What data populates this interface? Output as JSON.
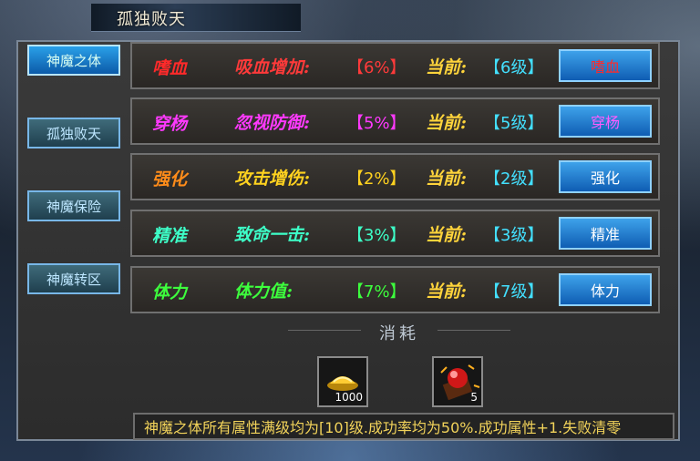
{
  "window": {
    "title": "孤独败天"
  },
  "sidebar": {
    "items": [
      {
        "label": "神魔之体",
        "active": true
      },
      {
        "label": "孤独败天",
        "active": false
      },
      {
        "label": "神魔保险",
        "active": false
      },
      {
        "label": "神魔转区",
        "active": false
      }
    ]
  },
  "rows": [
    {
      "name": "嗜血",
      "desc": "吸血增加:",
      "pct": "【6%】",
      "cur_label": "当前:",
      "level": "【6级】",
      "button": "嗜血",
      "name_color": "#ff2a2a",
      "desc_color": "#ff3a3a",
      "pct_color": "#ff3a3a",
      "btn_color": "#ff2a2a"
    },
    {
      "name": "穿杨",
      "desc": "忽视防御:",
      "pct": "【5%】",
      "cur_label": "当前:",
      "level": "【5级】",
      "button": "穿杨",
      "name_color": "#ff39ff",
      "desc_color": "#ff39ff",
      "pct_color": "#ff39ff",
      "btn_color": "#ff5cff"
    },
    {
      "name": "强化",
      "desc": "攻击增伤:",
      "pct": "【2%】",
      "cur_label": "当前:",
      "level": "【2级】",
      "button": "强化",
      "name_color": "#ff8c1a",
      "desc_color": "#ffd21f",
      "pct_color": "#ffd21f",
      "btn_color": "#ffffff"
    },
    {
      "name": "精准",
      "desc": "致命一击:",
      "pct": "【3%】",
      "cur_label": "当前:",
      "level": "【3级】",
      "button": "精准",
      "name_color": "#3dffc8",
      "desc_color": "#3dffc8",
      "pct_color": "#3dffc8",
      "btn_color": "#ffffff"
    },
    {
      "name": "体力",
      "desc": "体力值:",
      "pct": "【7%】",
      "cur_label": "当前:",
      "level": "【7级】",
      "button": "体力",
      "name_color": "#3dff3d",
      "desc_color": "#3dff3d",
      "pct_color": "#3dff3d",
      "btn_color": "#ffffff"
    }
  ],
  "consume": {
    "label": "消耗",
    "items": [
      {
        "icon": "gold-ingot-icon",
        "qty": "1000"
      },
      {
        "icon": "red-gem-scroll-icon",
        "qty": "5"
      }
    ]
  },
  "notice": "神魔之体所有属性满级均为[10]级.成功率均为50%.成功属性+1.失败清零"
}
